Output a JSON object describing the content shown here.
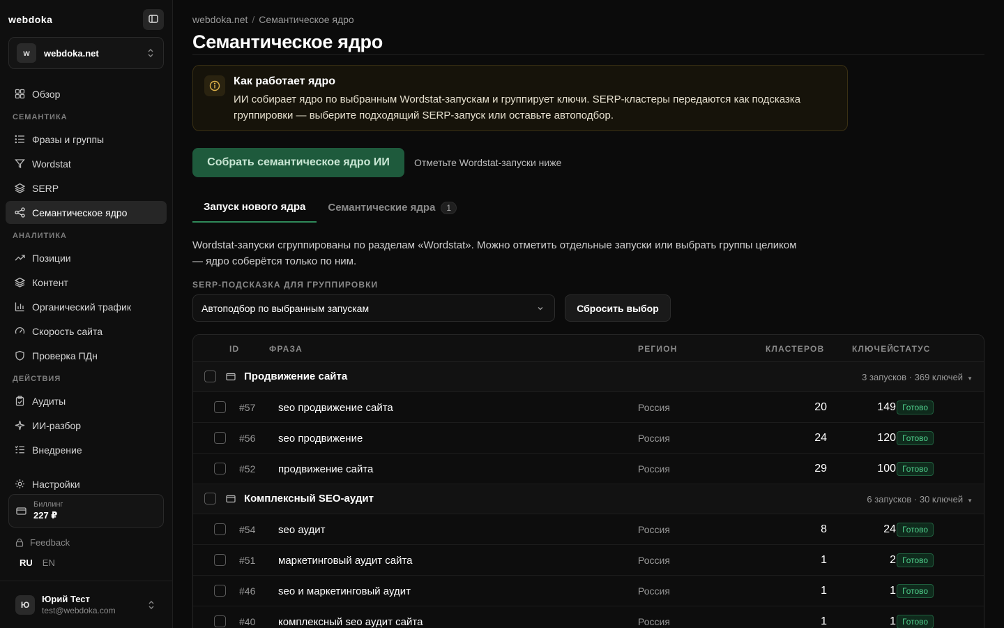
{
  "app": {
    "brand": "webdoka",
    "site": "webdoka.net",
    "site_initial": "w"
  },
  "nav": {
    "overview": "Обзор",
    "sections": {
      "semantics": "СЕМАНТИКА",
      "analytics": "АНАЛИТИКА",
      "actions": "ДЕЙСТВИЯ"
    },
    "semantics_items": [
      "Фразы и группы",
      "Wordstat",
      "SERP",
      "Семантическое ядро"
    ],
    "analytics_items": [
      "Позиции",
      "Контент",
      "Органический трафик",
      "Скорость сайта",
      "Проверка ПДн"
    ],
    "actions_items": [
      "Аудиты",
      "ИИ-разбор",
      "Внедрение"
    ],
    "settings": "Настройки"
  },
  "billing": {
    "label": "Биллинг",
    "value": "227 ₽"
  },
  "feedback": "Feedback",
  "lang": {
    "ru": "RU",
    "en": "EN"
  },
  "user": {
    "initial": "Ю",
    "name": "Юрий Тест",
    "email": "test@webdoka.com"
  },
  "breadcrumb": {
    "root": "webdoka.net",
    "sep": "/",
    "current": "Семантическое ядро"
  },
  "page_title": "Семантическое ядро",
  "info": {
    "title": "Как работает ядро",
    "text": "ИИ собирает ядро по выбранным Wordstat-запускам и группирует ключи. SERP-кластеры передаются как подсказка группировки — выберите подходящий SERP-запуск или оставьте автоподбор."
  },
  "actions": {
    "collect": "Собрать семантическое ядро ИИ",
    "hint": "Отметьте Wordstat-запуски ниже"
  },
  "tabs": {
    "new": "Запуск нового ядра",
    "cores": "Семантические ядра",
    "cores_count": "1"
  },
  "description": "Wordstat-запуски сгруппированы по разделам «Wordstat». Можно отметить отдельные запуски или выбрать группы целиком — ядро соберётся только по ним.",
  "serp_hint": {
    "label": "SERP-ПОДСКАЗКА ДЛЯ ГРУППИРОВКИ",
    "selected": "Автоподбор по выбранным запускам",
    "reset": "Сбросить выбор"
  },
  "table": {
    "headers": {
      "id": "ID",
      "phrase": "ФРАЗА",
      "region": "РЕГИОН",
      "clusters": "КЛАСТЕРОВ",
      "keys": "КЛЮЧЕЙ",
      "status": "СТАТУС"
    },
    "groups": [
      {
        "name": "Продвижение сайта",
        "meta": "3 запусков · 369 ключей",
        "rows": [
          {
            "id": "#57",
            "phrase": "seo продвижение сайта",
            "region": "Россия",
            "clusters": "20",
            "keys": "149",
            "status": "Готово"
          },
          {
            "id": "#56",
            "phrase": "seo продвижение",
            "region": "Россия",
            "clusters": "24",
            "keys": "120",
            "status": "Готово"
          },
          {
            "id": "#52",
            "phrase": "продвижение сайта",
            "region": "Россия",
            "clusters": "29",
            "keys": "100",
            "status": "Готово"
          }
        ]
      },
      {
        "name": "Комплексный SEO-аудит",
        "meta": "6 запусков · 30 ключей",
        "rows": [
          {
            "id": "#54",
            "phrase": "seo аудит",
            "region": "Россия",
            "clusters": "8",
            "keys": "24",
            "status": "Готово"
          },
          {
            "id": "#51",
            "phrase": "маркетинговый аудит сайта",
            "region": "Россия",
            "clusters": "1",
            "keys": "2",
            "status": "Готово"
          },
          {
            "id": "#46",
            "phrase": "seo и маркетинговый аудит",
            "region": "Россия",
            "clusters": "1",
            "keys": "1",
            "status": "Готово"
          },
          {
            "id": "#40",
            "phrase": "комплексный seo аудит сайта",
            "region": "Россия",
            "clusters": "1",
            "keys": "1",
            "status": "Готово"
          }
        ]
      }
    ]
  },
  "colors": {
    "accent": "#1e5a3c",
    "status_green": "#4fd08c",
    "info_border": "#3a3014"
  }
}
